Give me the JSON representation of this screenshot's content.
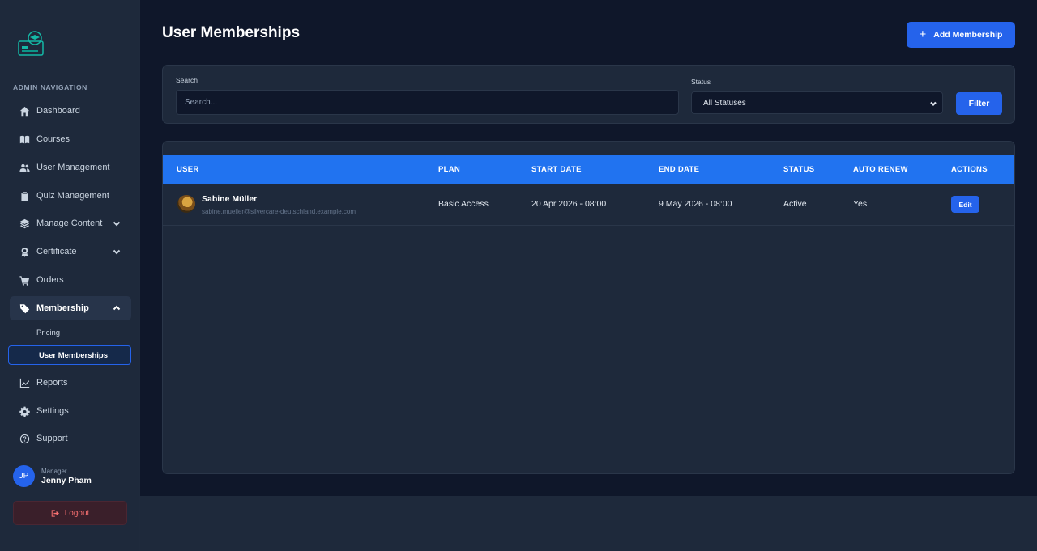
{
  "sidebar": {
    "heading": "ADMIN NAVIGATION",
    "items": [
      {
        "label": "Dashboard",
        "icon": "home-icon"
      },
      {
        "label": "Courses",
        "icon": "book-icon"
      },
      {
        "label": "User Management",
        "icon": "users-icon"
      },
      {
        "label": "Quiz Management",
        "icon": "clipboard-check-icon"
      },
      {
        "label": "Manage Content",
        "icon": "layers-icon"
      },
      {
        "label": "Certificate",
        "icon": "award-icon"
      },
      {
        "label": "Orders",
        "icon": "cart-icon"
      },
      {
        "label": "Membership",
        "icon": "tag-icon"
      },
      {
        "label": "Reports",
        "icon": "chart-line-icon"
      },
      {
        "label": "Settings",
        "icon": "gear-icon"
      },
      {
        "label": "Support",
        "icon": "question-circle-icon"
      }
    ],
    "subitems": [
      {
        "label": "Pricing"
      },
      {
        "label": "User Memberships"
      }
    ],
    "profile": {
      "initials": "JP",
      "role": "Manager",
      "name": "Jenny Pham"
    },
    "logout_label": "Logout"
  },
  "page": {
    "title": "User Memberships",
    "add_button_label": "Add Membership"
  },
  "filters": {
    "search_label": "Search",
    "search_placeholder": "Search...",
    "status_label": "Status",
    "status_selected": "All Statuses",
    "filter_button_label": "Filter"
  },
  "table": {
    "columns": [
      "USER",
      "PLAN",
      "START DATE",
      "END DATE",
      "STATUS",
      "AUTO RENEW",
      "ACTIONS"
    ],
    "rows": [
      {
        "name": "Sabine Müller",
        "email": "sabine.mueller@silvercare-deutschland.example.com",
        "plan": "Basic Access",
        "start_date": "20 Apr 2026 - 08:00",
        "end_date": "9 May 2026 - 08:00",
        "status": "Active",
        "auto_renew": "Yes",
        "action_label": "Edit"
      }
    ]
  },
  "colors": {
    "accent": "#2563eb",
    "table_header": "#2173f0",
    "background": "#0f172a",
    "panel": "#1e293b",
    "danger": "#f87171"
  }
}
